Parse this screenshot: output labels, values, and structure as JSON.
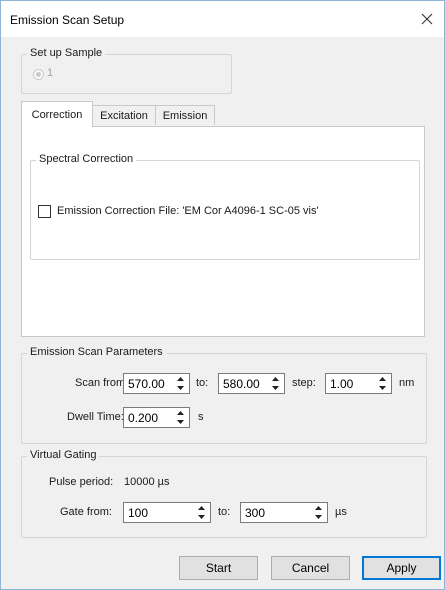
{
  "window": {
    "title": "Emission Scan Setup"
  },
  "sample_group": {
    "label": "Set up Sample",
    "option_label": "1"
  },
  "tabs": [
    {
      "label": "Correction"
    },
    {
      "label": "Excitation"
    },
    {
      "label": "Emission"
    }
  ],
  "correction": {
    "group_label": "Spectral Correction",
    "checkbox_label": "Emission Correction File: 'EM Cor A4096-1 SC-05 vis'",
    "checked": false
  },
  "scan_params": {
    "group_label": "Emission Scan Parameters",
    "scan_from_label": "Scan from:",
    "scan_from_value": "570.00",
    "to_label": "to:",
    "to_value": "580.00",
    "step_label": "step:",
    "step_value": "1.00",
    "unit_label": "nm",
    "dwell_label": "Dwell Time:",
    "dwell_value": "0.200",
    "dwell_unit": "s"
  },
  "gating": {
    "group_label": "Virtual Gating",
    "pulse_label": "Pulse period:",
    "pulse_value": "10000 µs",
    "gate_from_label": "Gate from:",
    "gate_from_value": "100",
    "to_label": "to:",
    "to_value": "300",
    "unit_label": "µs"
  },
  "buttons": {
    "start": "Start",
    "cancel": "Cancel",
    "apply": "Apply"
  }
}
